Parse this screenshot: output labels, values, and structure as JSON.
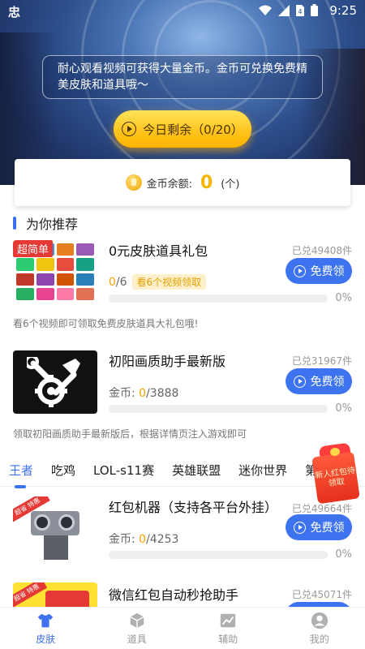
{
  "status_bar": {
    "app_icon": "忠",
    "time": "9:25",
    "icons": [
      "wifi-icon",
      "signal-icon",
      "sim-icon",
      "battery-icon"
    ]
  },
  "hero": {
    "notice": "耐心观看视频可获得大量金币。金币可兑换免费精美皮肤和道具哦〜",
    "today_button": "今日剩余（0/20）"
  },
  "balance": {
    "label": "金币余额:",
    "value": "0",
    "unit": "(个)"
  },
  "section": {
    "title": "为你推荐"
  },
  "items": [
    {
      "title": "0元皮肤道具礼包",
      "redeemed": "已兑49408件",
      "button": "免费领",
      "progress_current": "0",
      "progress_total": "/6",
      "tag": "看6个视频领取",
      "percent": "0%",
      "desc": "看6个视频即可领取免费皮肤道具大礼包哦!",
      "badge": "超简单"
    },
    {
      "title": "初阳画质助手最新版",
      "redeemed": "已兑31967件",
      "button": "免费领",
      "coins_label": "金币: ",
      "coins_current": "0",
      "coins_total": "/3888",
      "percent": "0%",
      "desc": "领取初阳画质助手最新版后，根据详情页注入游戏即可"
    }
  ],
  "tabs": [
    "王者",
    "吃鸡",
    "LOL-s11赛",
    "英雄联盟",
    "迷你世界",
    "第五人格"
  ],
  "active_tab": 0,
  "redpack": {
    "text": "新人红包待领取"
  },
  "list_items": [
    {
      "title": "红包机器（支持各平台外挂）",
      "redeemed": "已兑49664件",
      "button": "免费领",
      "coins_label": "金币: ",
      "coins_current": "0",
      "coins_total": "/4253",
      "percent": "0%",
      "ribbon": "超省 特惠"
    },
    {
      "title": "微信红包自动秒抢助手",
      "redeemed": "已兑45071件",
      "ribbon": "超省 特惠"
    }
  ],
  "bottom_nav": [
    {
      "label": "皮肤",
      "icon": "shirt-icon",
      "active": true
    },
    {
      "label": "道具",
      "icon": "cube-icon",
      "active": false
    },
    {
      "label": "辅助",
      "icon": "chart-icon",
      "active": false
    },
    {
      "label": "我的",
      "icon": "user-icon",
      "active": false
    }
  ],
  "colors": {
    "accent": "#3d73ef",
    "coin": "#f5a200",
    "gold_button": "#ffc21a"
  }
}
